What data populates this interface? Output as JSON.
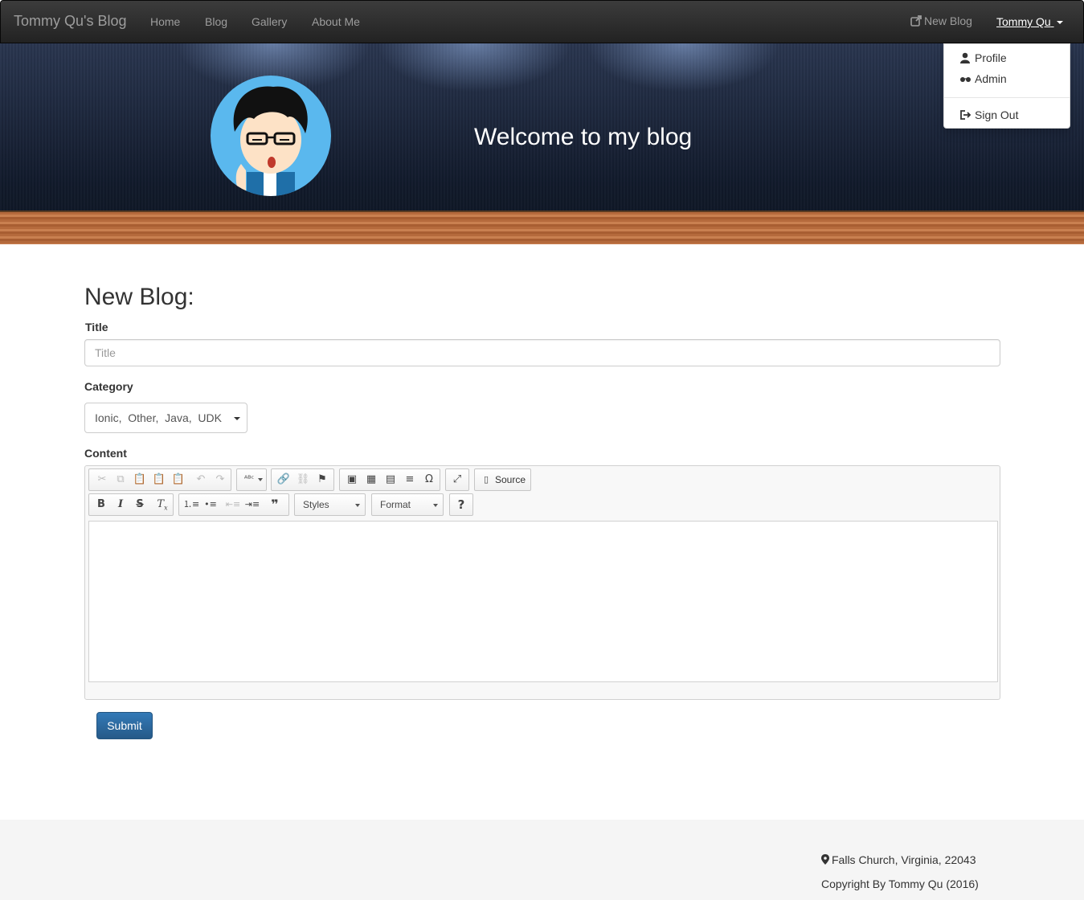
{
  "navbar": {
    "brand": "Tommy Qu's Blog",
    "links": [
      "Home",
      "Blog",
      "Gallery",
      "About Me"
    ],
    "new_blog": "New Blog",
    "user": "Tommy Qu"
  },
  "user_menu": {
    "items": [
      "Profile",
      "Admin",
      "Sign Out"
    ]
  },
  "hero": {
    "title": "Welcome to my blog"
  },
  "form": {
    "heading": "New Blog:",
    "title_label": "Title",
    "title_placeholder": "Title",
    "category_label": "Category",
    "category_value": "Ionic,  Other,  Java,  UDK",
    "content_label": "Content",
    "submit": "Submit"
  },
  "editor": {
    "source_label": "Source",
    "styles_label": "Styles",
    "format_label": "Format",
    "help_label": "?"
  },
  "footer": {
    "address": "Falls Church, Virginia, 22043",
    "copyright": "Copyright By Tommy Qu (2016)"
  },
  "colors": {
    "navbar": "#222222",
    "primary": "#337ab7",
    "avatar_bg": "#5ab8ee"
  }
}
